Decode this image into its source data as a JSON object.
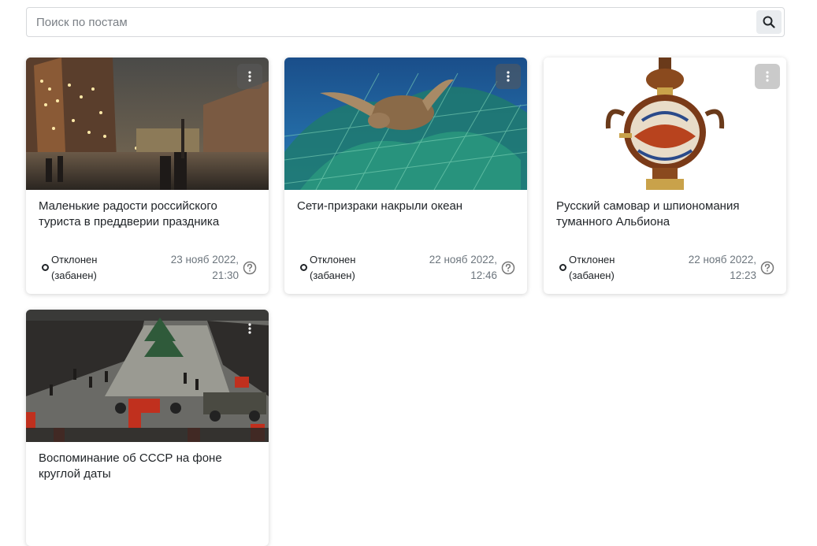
{
  "search": {
    "placeholder": "Поиск по постам",
    "value": "",
    "button_icon": "search-icon"
  },
  "posts": [
    {
      "title": "Маленькие радости российского туриста в преддверии праздника",
      "status_line1": "Отклонен",
      "status_line2": "(забанен)",
      "date_line1": "23 нояб 2022,",
      "date_line2": "21:30",
      "image": "night-city-street-image",
      "menu_icon": "more-vertical-icon",
      "help_icon": "help-circle-icon"
    },
    {
      "title": "Сети-призраки накрыли океан",
      "status_line1": "Отклонен",
      "status_line2": "(забанен)",
      "date_line1": "22 нояб 2022,",
      "date_line2": "12:46",
      "image": "turtle-in-net-image",
      "menu_icon": "more-vertical-icon",
      "help_icon": "help-circle-icon"
    },
    {
      "title": "Русский самовар и шпиономания туманного Альбиона",
      "status_line1": "Отклонен",
      "status_line2": "(забанен)",
      "date_line1": "22 нояб 2022,",
      "date_line2": "12:23",
      "image": "samovar-image",
      "menu_icon": "more-vertical-icon",
      "help_icon": "help-circle-icon"
    },
    {
      "title": "Воспоминание об СССР на фоне круглой даты",
      "image": "ussr-parade-image",
      "menu_icon": "more-vertical-icon"
    }
  ],
  "colors": {
    "text": "#212529",
    "muted": "#6c757d",
    "border": "#d6d8db",
    "search_button_bg": "#e9ecef"
  }
}
